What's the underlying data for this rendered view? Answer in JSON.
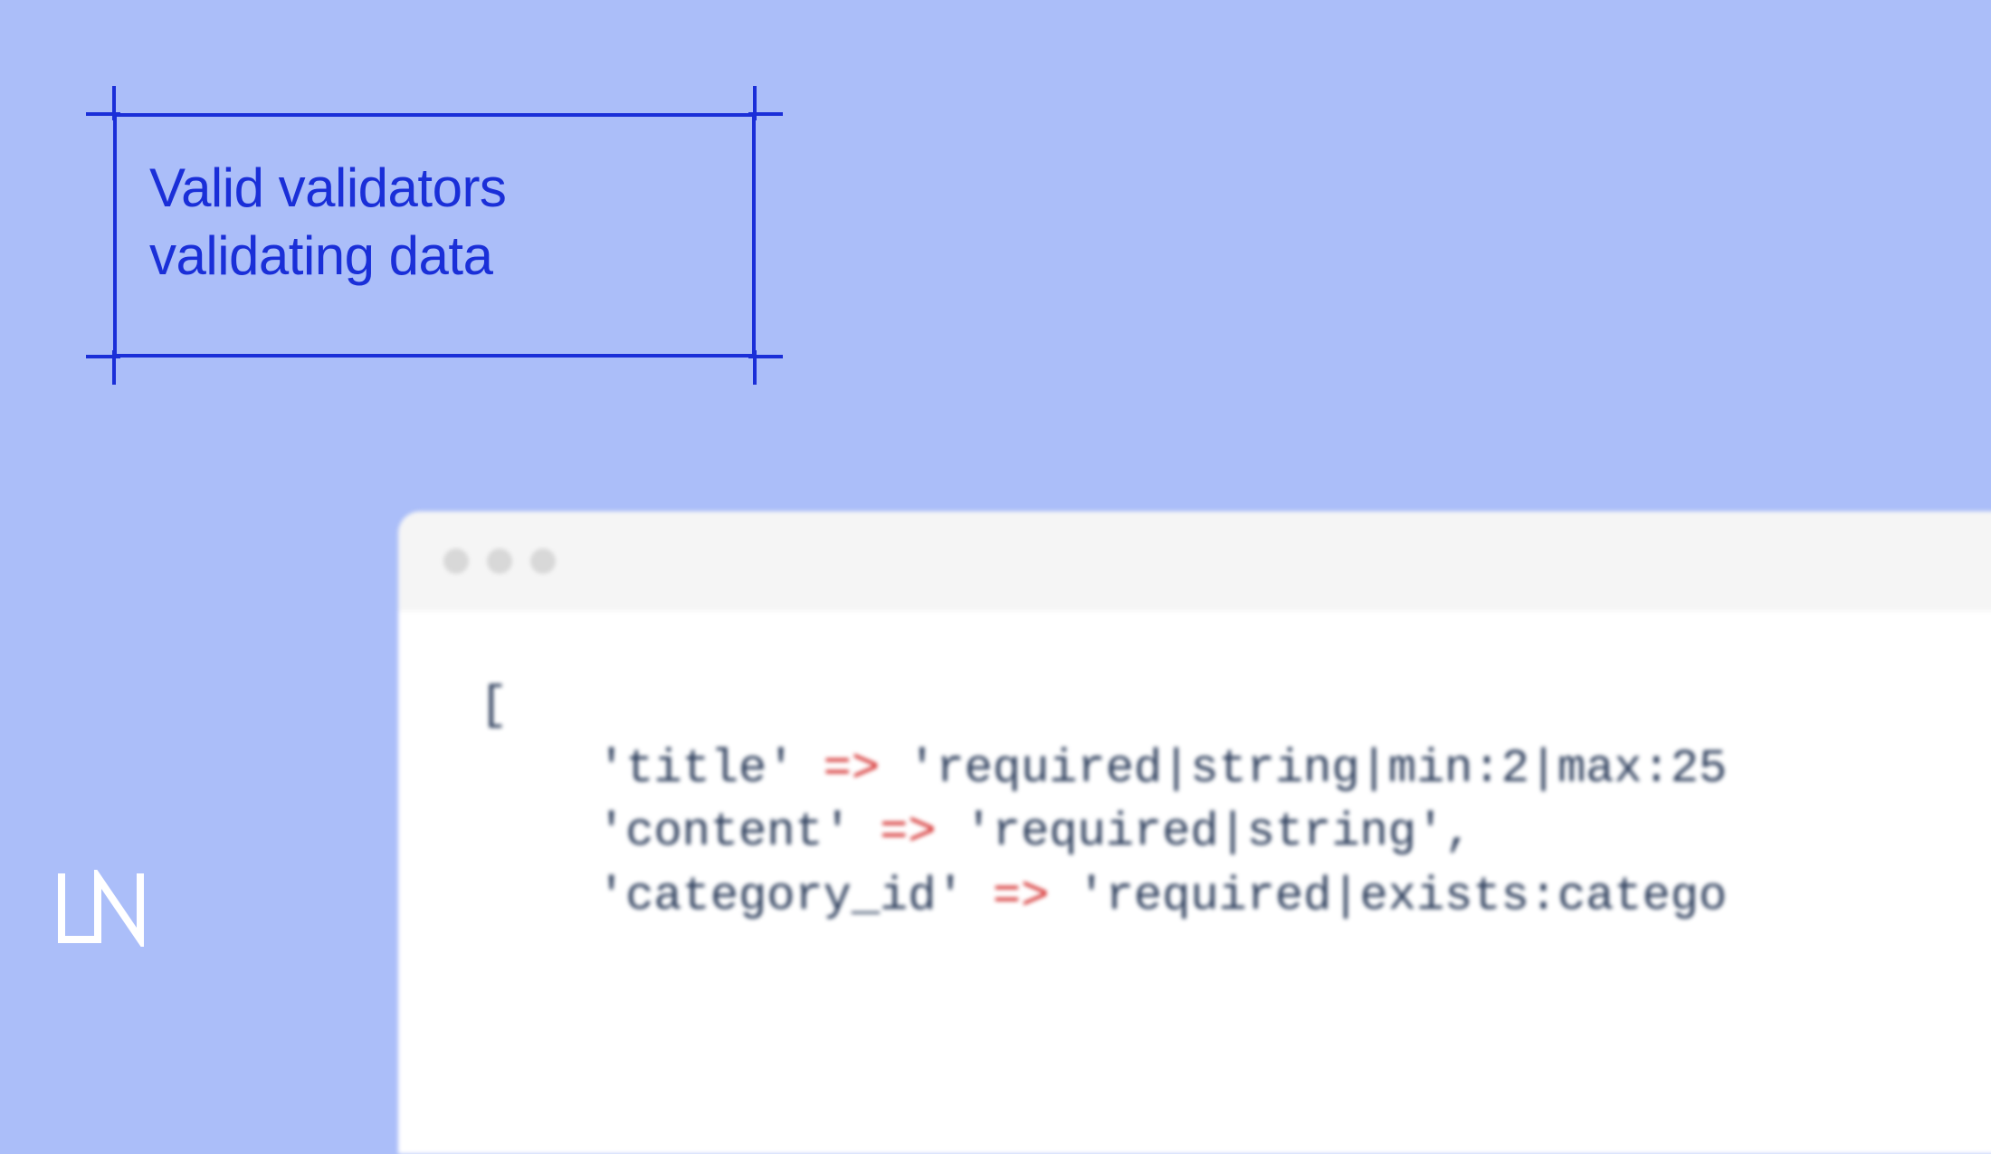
{
  "title": {
    "line1": "Valid validators",
    "line2": "validating data"
  },
  "code": {
    "open_bracket": "[",
    "lines": [
      {
        "key": "'title'",
        "arrow": " => ",
        "value": "'required|string|min:2|max:25"
      },
      {
        "key": "'content'",
        "arrow": " => ",
        "value": "'required|string',"
      },
      {
        "key": "'category_id'",
        "arrow": " => ",
        "value": "'required|exists:catego"
      }
    ]
  },
  "logo_text": "LN"
}
